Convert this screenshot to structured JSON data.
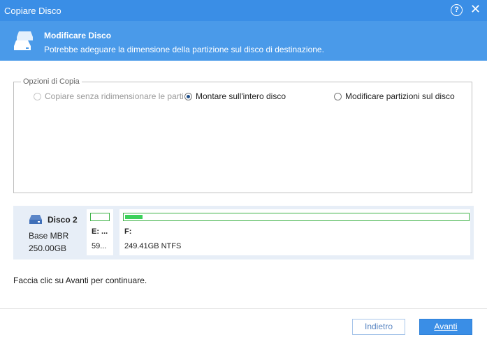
{
  "window": {
    "title": "Copiare Disco"
  },
  "header": {
    "title": "Modificare Disco",
    "subtitle": "Potrebbe adeguare la dimensione della partizione sul disco di destinazione."
  },
  "options": {
    "legend": "Opzioni di Copia",
    "items": [
      {
        "label": "Copiare senza ridimensionare le parti",
        "checked": false,
        "disabled": true
      },
      {
        "label": "Montare sull'intero disco",
        "checked": true,
        "disabled": false
      },
      {
        "label": "Modificare partizioni sul disco",
        "checked": false,
        "disabled": false
      }
    ]
  },
  "disk": {
    "name": "Disco 2",
    "type": "Base MBR",
    "size": "250.00GB",
    "partitions": [
      {
        "letter": "E: ...",
        "info": "59...",
        "used_fraction": 0.0
      },
      {
        "letter": "F:",
        "info": "249.41GB NTFS",
        "used_fraction": 0.05
      }
    ]
  },
  "hint": "Faccia clic su Avanti per continuare.",
  "buttons": {
    "back": "Indietro",
    "next": "Avanti"
  },
  "colors": {
    "accent": "#3a8ee6",
    "header": "#4a9ae9",
    "partition_fill": "#3cd05a"
  }
}
